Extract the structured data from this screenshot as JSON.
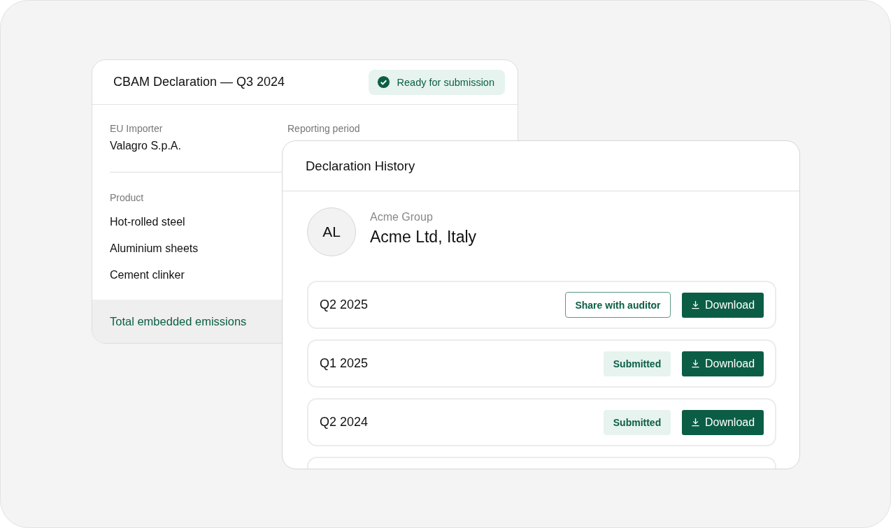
{
  "declaration_card": {
    "title": "CBAM Declaration — Q3 2024",
    "status": {
      "label": "Ready for submission",
      "ready": true
    },
    "fields": [
      {
        "label": "EU Importer",
        "value": "Valagro S.p.A."
      },
      {
        "label": "Reporting period"
      }
    ],
    "table": {
      "columns": [
        "Product"
      ],
      "rows": [
        "Hot-rolled steel",
        "Aluminium sheets",
        "Cement clinker"
      ]
    },
    "footer": "Total embedded emissions"
  },
  "history_card": {
    "title": "Declaration History",
    "avatar": "AL",
    "group": "Acme Group",
    "company": "Acme Ltd, Italy",
    "rows": [
      {
        "period": "Q2 2025",
        "action": {
          "kind": "share",
          "label": "Share with auditor"
        },
        "download": "Download"
      },
      {
        "period": "Q1 2025",
        "action": {
          "kind": "status",
          "label": "Submitted"
        },
        "download": "Download"
      },
      {
        "period": "Q2 2024",
        "action": {
          "kind": "status",
          "label": "Submitted"
        },
        "download": "Download"
      },
      {
        "kind": "cut"
      }
    ]
  }
}
